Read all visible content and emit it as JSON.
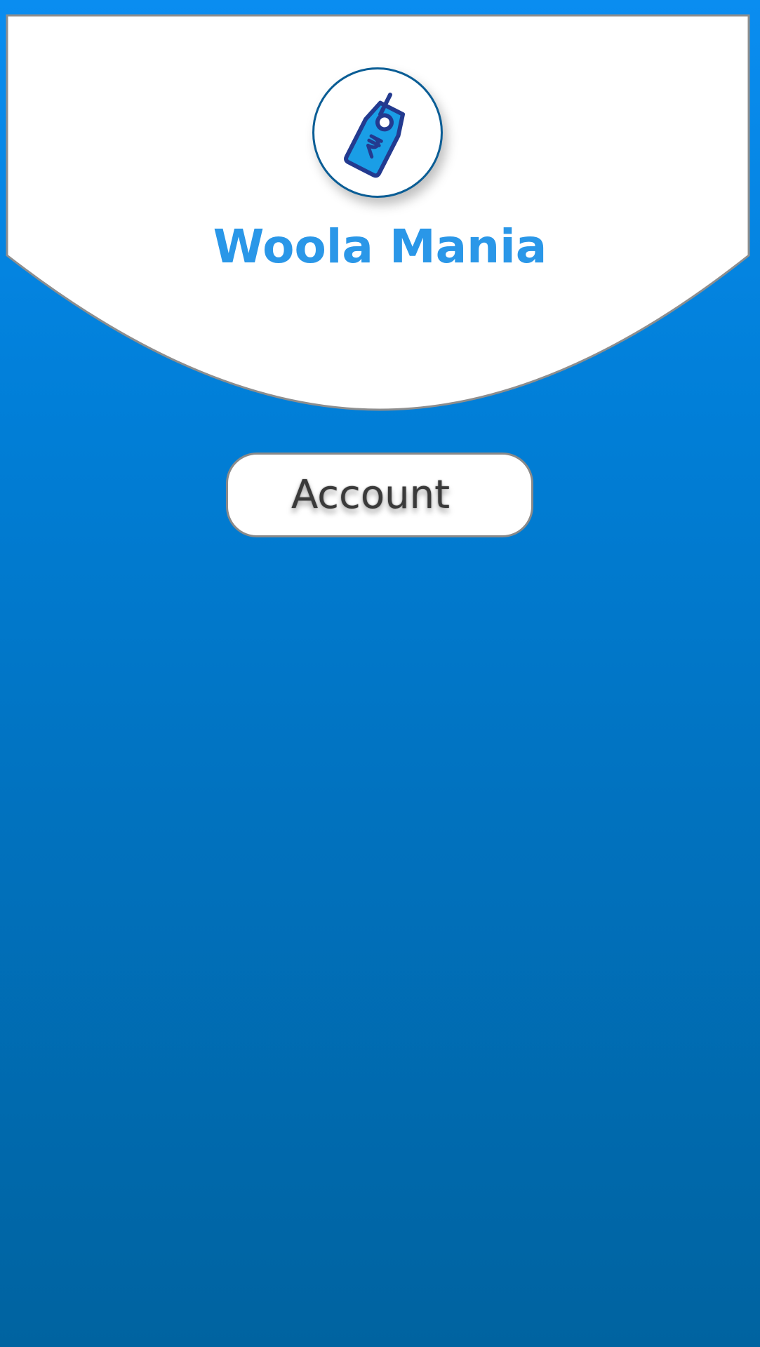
{
  "app": {
    "title": "Woola Mania",
    "logo_icon": "price-tag-rupee-icon"
  },
  "actions": {
    "account_label": "Account"
  },
  "colors": {
    "background_top": "#0a8df0",
    "background_bottom": "#0063a0",
    "title_color": "#2a97e8",
    "tag_fill": "#1a9ee6",
    "tag_stroke": "#233a8f",
    "panel_fill": "#ffffff"
  }
}
